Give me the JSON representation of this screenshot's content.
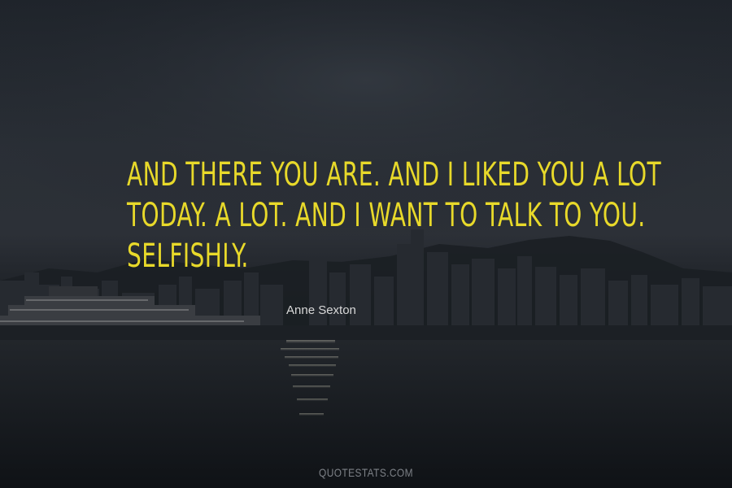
{
  "quote": {
    "lines": [
      "And there you are. And I liked you a lot",
      "today. A lot. And I want to talk to you.",
      "Selfishly."
    ]
  },
  "author": "Anne Sexton",
  "footer": "QUOTESTATS.COM",
  "colors": {
    "quote_text": "#e8d92a",
    "author_text": "#d8d8d8",
    "footer_text": "#7d8187",
    "background": "#1a1e24"
  }
}
